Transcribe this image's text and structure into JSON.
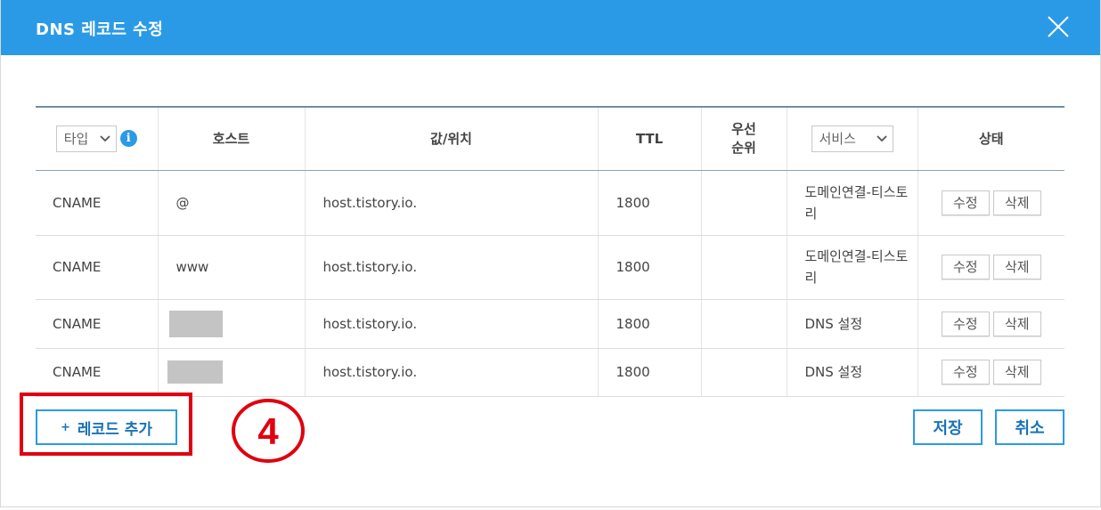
{
  "dialog": {
    "title": "DNS 레코드 수정",
    "accent_color": "#2b9ae6",
    "close_icon": "close-icon"
  },
  "table": {
    "headers": {
      "type_filter": "타입",
      "host": "호스트",
      "value": "값/위치",
      "ttl": "TTL",
      "priority_line1": "우선",
      "priority_line2": "순위",
      "service_filter": "서비스",
      "status": "상태"
    },
    "rows": [
      {
        "type": "CNAME",
        "host": "@",
        "value": "host.tistory.io.",
        "ttl": "1800",
        "priority": "",
        "service": "도메인연결-티스토리",
        "edit": "수정",
        "delete": "삭제"
      },
      {
        "type": "CNAME",
        "host": "www",
        "value": "host.tistory.io.",
        "ttl": "1800",
        "priority": "",
        "service": "도메인연결-티스토리",
        "edit": "수정",
        "delete": "삭제"
      },
      {
        "type": "CNAME",
        "host": "",
        "value": "host.tistory.io.",
        "ttl": "1800",
        "priority": "",
        "service": "DNS 설정",
        "edit": "수정",
        "delete": "삭제"
      },
      {
        "type": "CNAME",
        "host": "",
        "value": "host.tistory.io.",
        "ttl": "1800",
        "priority": "",
        "service": "DNS 설정",
        "edit": "수정",
        "delete": "삭제"
      }
    ]
  },
  "footer": {
    "add_plus": "+",
    "add_record": "레코드 추가",
    "save": "저장",
    "cancel": "취소"
  },
  "annotation": {
    "step_number": "4",
    "color": "#e0000f"
  }
}
